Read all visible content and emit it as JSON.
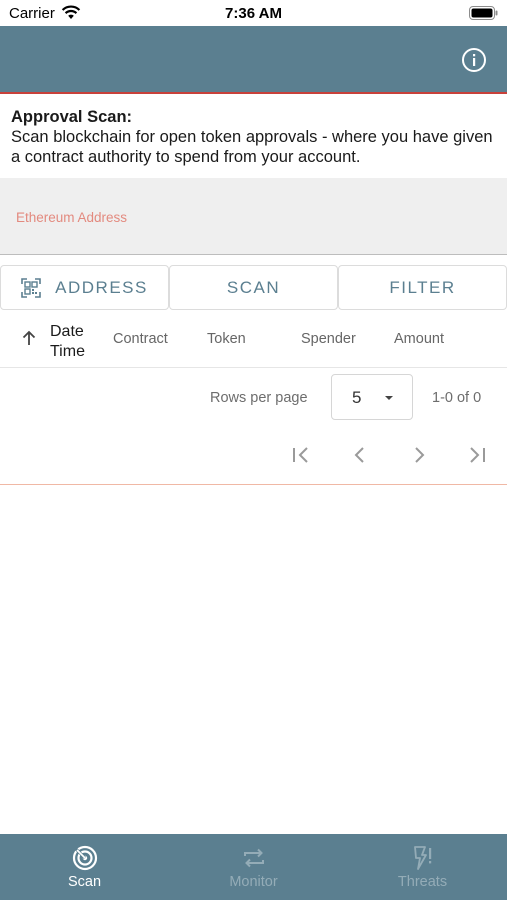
{
  "status_bar": {
    "carrier": "Carrier",
    "time": "7:36 AM"
  },
  "app_bar": {
    "info_icon": "info-icon"
  },
  "intro": {
    "title": "Approval Scan:",
    "text": "Scan blockchain for open token approvals - where you have given a contract authority to spend from your account."
  },
  "address_input": {
    "placeholder": "Ethereum Address",
    "value": ""
  },
  "buttons": {
    "address": "ADDRESS",
    "scan": "SCAN",
    "filter": "FILTER"
  },
  "table": {
    "columns": {
      "date_line1": "Date",
      "date_line2": "Time",
      "contract": "Contract",
      "token": "Token",
      "spender": "Spender",
      "amount": "Amount"
    },
    "sort_icon": "arrow-up-icon",
    "rows": []
  },
  "pagination": {
    "rows_per_page_label": "Rows per page",
    "rows_per_page": "5",
    "range": "1-0 of 0"
  },
  "tabs": [
    {
      "label": "Scan",
      "icon": "radar-icon",
      "active": true
    },
    {
      "label": "Monitor",
      "icon": "repeat-icon",
      "active": false
    },
    {
      "label": "Threats",
      "icon": "flash-alert-icon",
      "active": false
    }
  ],
  "colors": {
    "primary": "#5b7f90",
    "accent": "#c8413a",
    "placeholder": "#e38a7f"
  }
}
